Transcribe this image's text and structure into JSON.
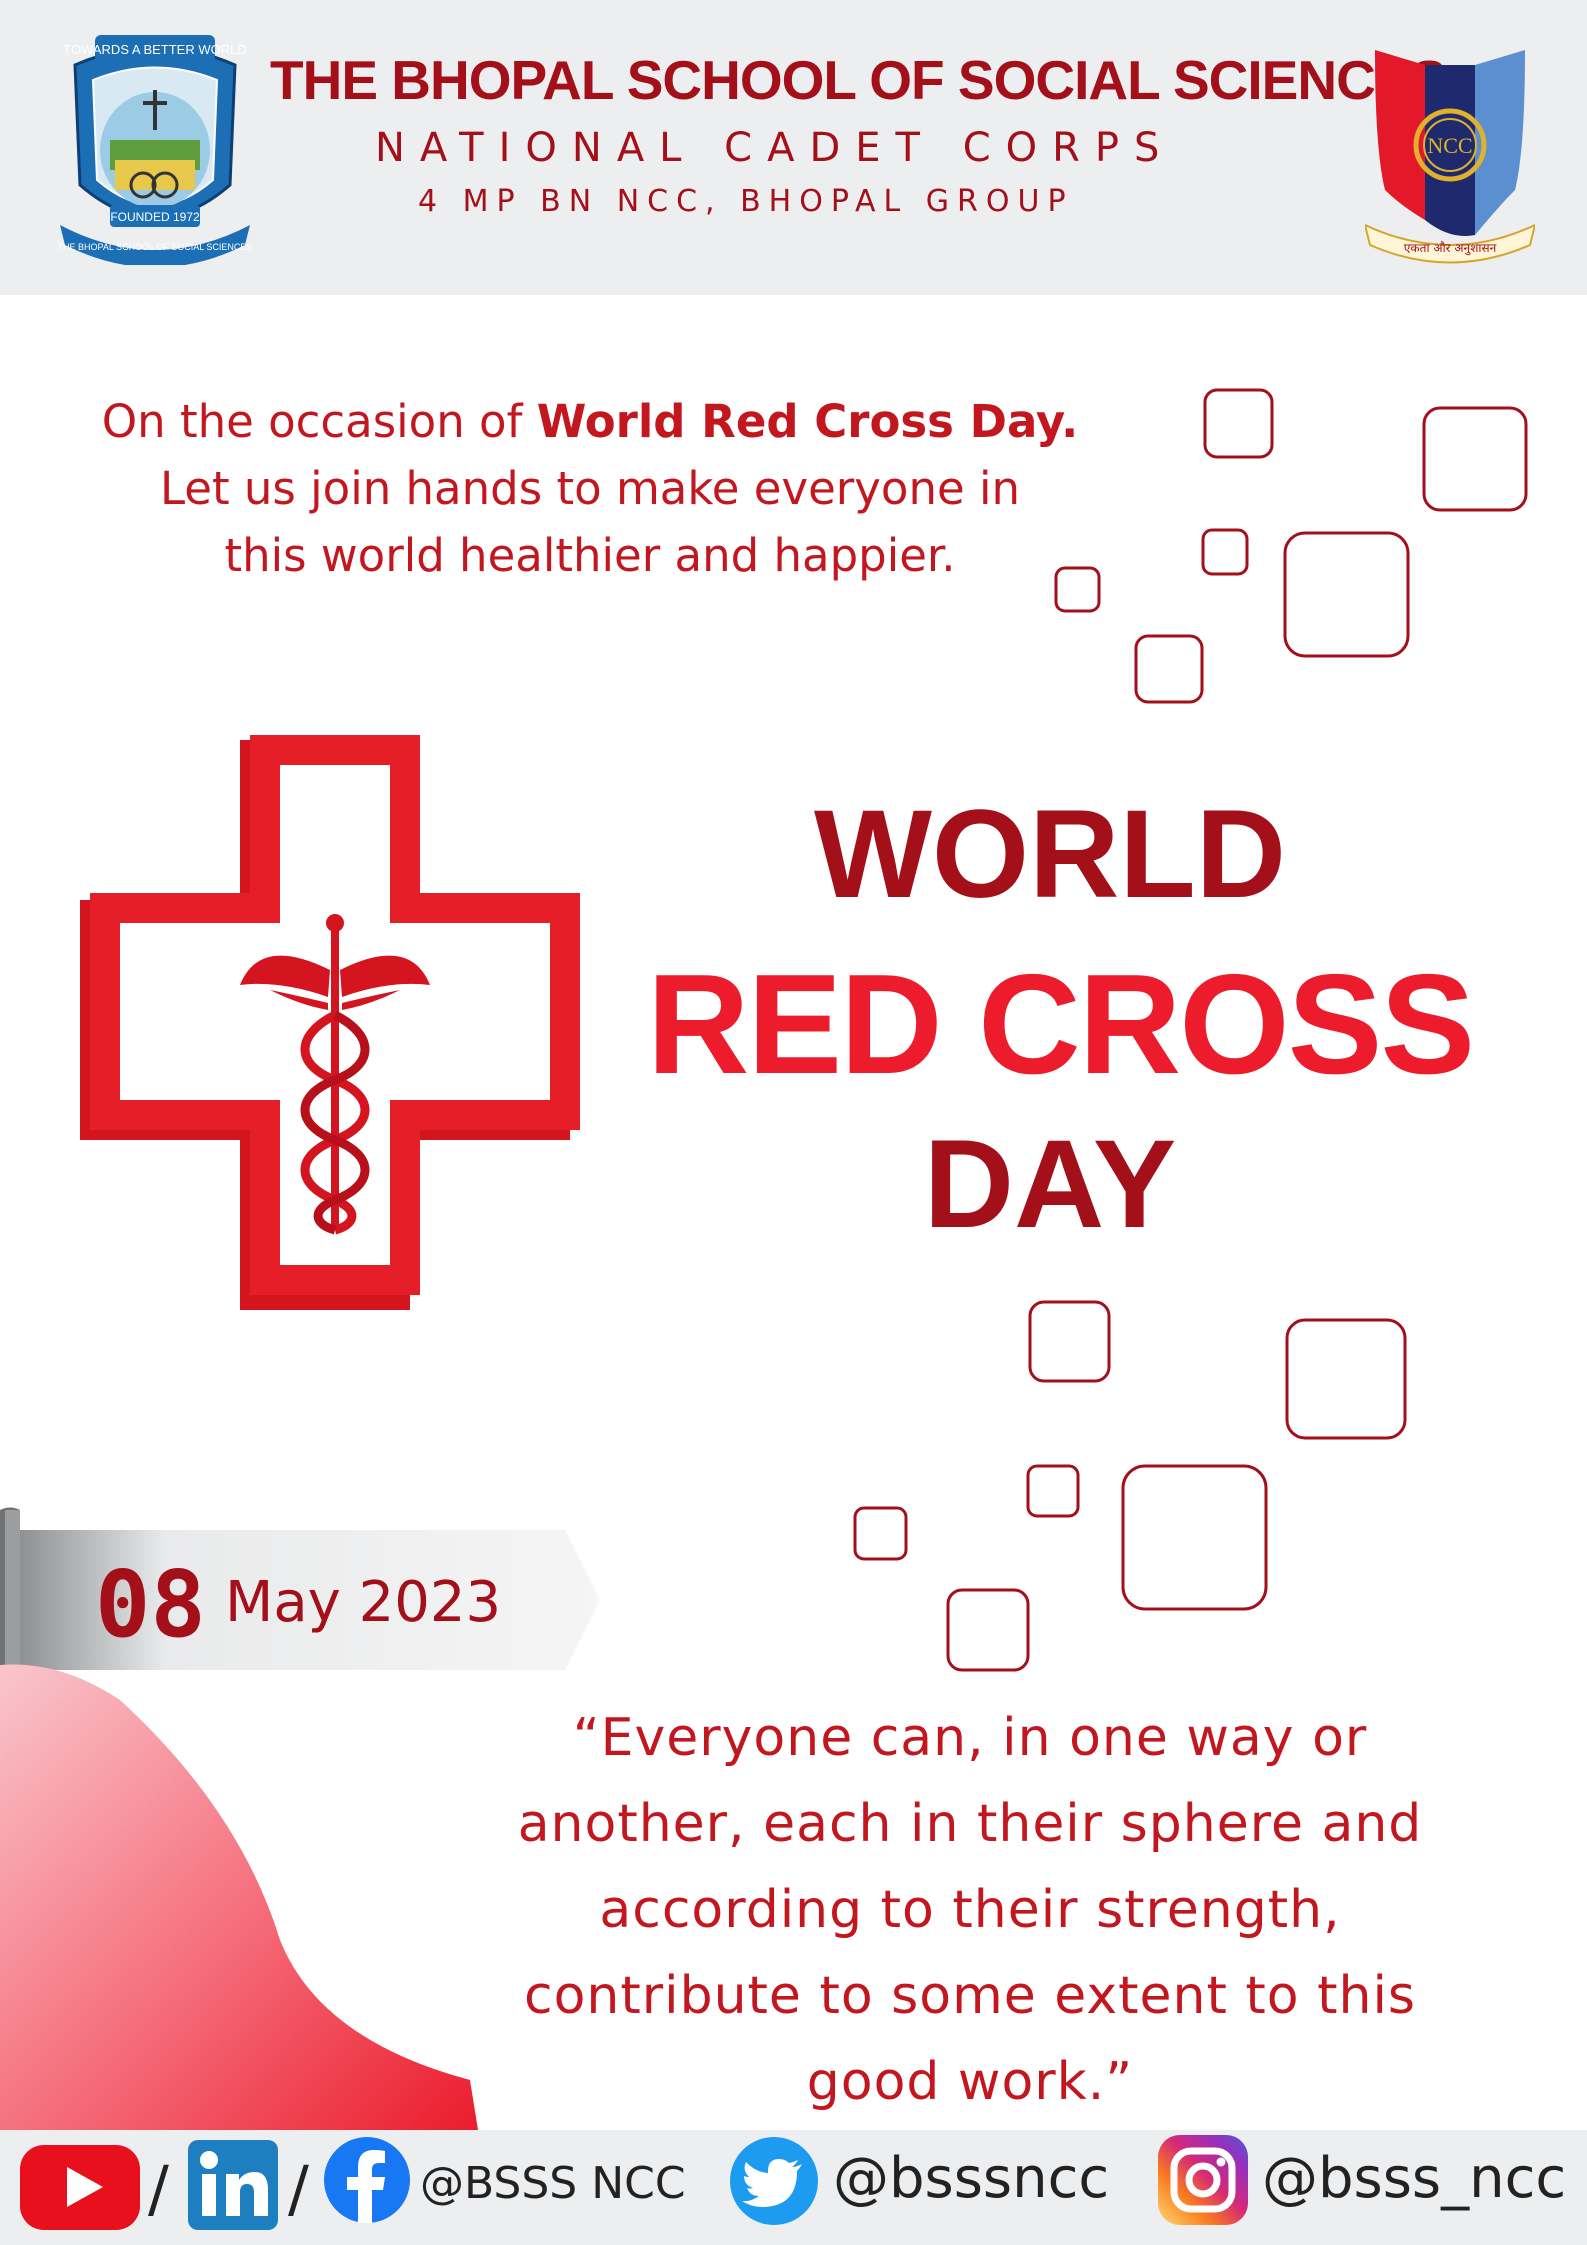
{
  "header": {
    "school_name": "THE BHOPAL SCHOOL OF SOCIAL SCIENCES",
    "ncc": "NATIONAL CADET CORPS",
    "battalion": "4 MP BN NCC, BHOPAL GROUP",
    "logo_left": {
      "top_text": "TOWARDS A BETTER WORLD",
      "founded": "FOUNDED 1972",
      "bottom_text": "THE BHOPAL SCHOOL OF SOCIAL SCIENCES"
    },
    "logo_right": {
      "emblem_text": "NCC",
      "motto": "एकता और अनुशासन"
    }
  },
  "intro": {
    "line1_pre": "On the occasion of ",
    "line1_bold": "World Red Cross Day.",
    "line2": "Let us join hands to make everyone in",
    "line3": "this world healthier and happier."
  },
  "title": {
    "line1": "WORLD",
    "line2": "RED CROSS",
    "line3": "DAY"
  },
  "date": {
    "day": "08",
    "month_year": "May 2023"
  },
  "quote": {
    "lines": [
      "“Everyone can, in one way or",
      "another, each in their sphere and",
      "according to their strength,",
      "contribute to some extent to this",
      "good work.”"
    ]
  },
  "footer": {
    "slash": "/",
    "handle_fb": "@BSSS NCC",
    "handle_twitter": "@bsssncc",
    "handle_instagram": "@bsss_ncc",
    "icons": [
      "youtube-icon",
      "linkedin-icon",
      "facebook-icon",
      "twitter-icon",
      "instagram-icon"
    ]
  },
  "colors": {
    "dark_red": "#a3101a",
    "bright_red": "#ec1c2c",
    "text_red": "#c3171f",
    "header_bg": "#eceef0"
  }
}
